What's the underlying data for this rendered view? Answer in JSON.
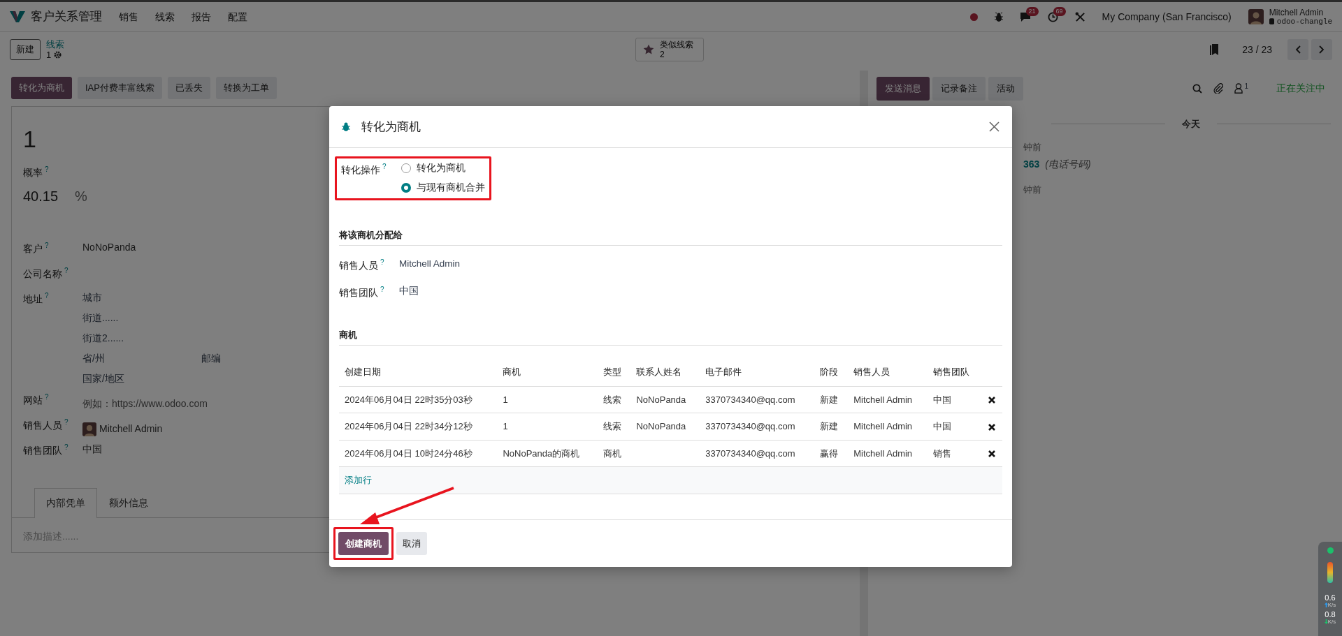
{
  "navbar": {
    "app_title": "客户关系管理",
    "menu": [
      "销售",
      "线索",
      "报告",
      "配置"
    ],
    "notifications": [
      {
        "kind": "chat",
        "count": "21"
      },
      {
        "kind": "activity",
        "count": "69"
      }
    ],
    "company": "My Company (San Francisco)",
    "user": {
      "name": "Mitchell Admin",
      "database": "odoo-changle"
    }
  },
  "control_panel": {
    "new_button": "新建",
    "breadcrumb": "线索",
    "record": "1",
    "smart_button": {
      "label": "类似线索",
      "count": "2"
    },
    "pager": "23 / 23"
  },
  "status_buttons": [
    {
      "label": "转化为商机",
      "primary": true
    },
    {
      "label": "IAP付费丰富线索",
      "primary": false
    },
    {
      "label": "已丢失",
      "primary": false
    },
    {
      "label": "转换为工单",
      "primary": false
    }
  ],
  "form": {
    "title": "1",
    "probability": {
      "label": "概率",
      "hint": "?",
      "value": "40.15",
      "unit": "%"
    },
    "fields": [
      {
        "kind": "text",
        "label": "客户",
        "hint": "?",
        "value": "NoNoPanda"
      },
      {
        "kind": "text",
        "label": "公司名称",
        "hint": "?"
      },
      {
        "kind": "address",
        "label": "地址",
        "hint": "?",
        "lines": [
          {
            "parts": [
              "城市"
            ]
          },
          {
            "parts": [
              "街道......"
            ]
          },
          {
            "parts": [
              "街道2......"
            ]
          },
          {
            "parts": [
              "省/州",
              "邮编"
            ]
          },
          {
            "parts": [
              "国家/地区"
            ]
          }
        ]
      },
      {
        "kind": "text",
        "label": "网站",
        "hint": "?",
        "placeholder": "例如：https://www.odoo.com"
      },
      {
        "kind": "avatar",
        "label": "销售人员",
        "hint": "?",
        "value": "Mitchell Admin"
      },
      {
        "kind": "text",
        "label": "销售团队",
        "hint": "?",
        "value": "中国"
      }
    ],
    "tabs": [
      {
        "label": "内部凭单",
        "selected": true
      },
      {
        "label": "额外信息",
        "selected": false
      }
    ],
    "notes_placeholder": "添加描述......"
  },
  "chatter": {
    "buttons": [
      {
        "label": "发送消息",
        "primary": true
      },
      {
        "label": "记录备注",
        "primary": false
      },
      {
        "label": "活动",
        "primary": false
      }
    ],
    "follower_count": "1",
    "follow_status": "正在关注中",
    "date_divider": "今天",
    "messages": [
      {
        "time": "钟前",
        "value": "363",
        "note": "(电话号码)"
      },
      {
        "time": "钟前"
      }
    ]
  },
  "modal": {
    "title": "转化为商机",
    "conversion": {
      "label": "转化操作",
      "hint": "?",
      "highlighted": true,
      "options": [
        {
          "label": "转化为商机",
          "selected": false
        },
        {
          "label": "与现有商机合并",
          "selected": true
        }
      ]
    },
    "assign_heading": "将该商机分配给",
    "assign_fields": [
      {
        "label": "销售人员",
        "hint": "?",
        "value": "Mitchell Admin"
      },
      {
        "label": "销售团队",
        "hint": "?",
        "value": "中国"
      }
    ],
    "opportunities_heading": "商机",
    "table": {
      "columns": [
        "创建日期",
        "商机",
        "类型",
        "联系人姓名",
        "电子邮件",
        "阶段",
        "销售人员",
        "销售团队"
      ],
      "rows": [
        {
          "cells": [
            "2024年06月04日 22时35分03秒",
            "1",
            "线索",
            "NoNoPanda",
            "3370734340@qq.com",
            "新建",
            "Mitchell Admin",
            "中国"
          ]
        },
        {
          "cells": [
            "2024年06月04日 22时34分12秒",
            "1",
            "线索",
            "NoNoPanda",
            "3370734340@qq.com",
            "新建",
            "Mitchell Admin",
            "中国"
          ]
        },
        {
          "cells": [
            "2024年06月04日 10时24分46秒",
            "NoNoPanda的商机",
            "商机",
            null,
            "3370734340@qq.com",
            "赢得",
            "Mitchell Admin",
            "销售"
          ]
        }
      ],
      "add_line": "添加行"
    },
    "buttons": [
      {
        "label": "创建商机",
        "kind": "primary",
        "highlighted": true
      },
      {
        "label": "取消",
        "kind": "secondary",
        "highlighted": false
      }
    ]
  },
  "network_widget": {
    "upload": "0.6",
    "upload_unit": "K/s",
    "download": "0.8",
    "download_unit": "K/s"
  }
}
